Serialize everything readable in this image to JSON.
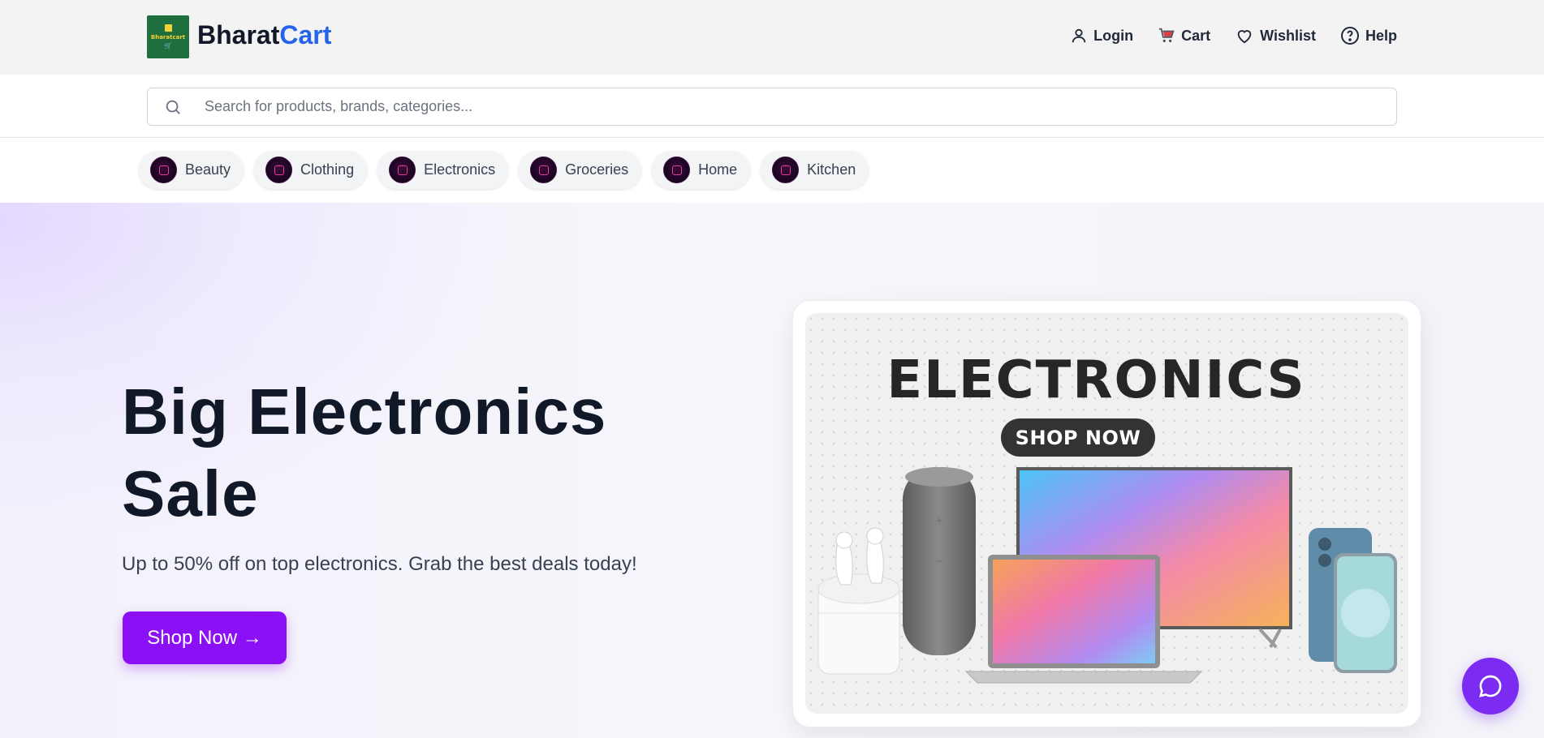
{
  "header": {
    "logo_text": "Bharatcart",
    "brand_part1": "Bharat",
    "brand_part2": "Cart",
    "brand_color": "#2563eb",
    "nav": [
      {
        "label": "Login",
        "icon": "user-icon"
      },
      {
        "label": "Cart",
        "icon": "cart-icon"
      },
      {
        "label": "Wishlist",
        "icon": "heart-icon"
      },
      {
        "label": "Help",
        "icon": "help-circle-icon"
      }
    ]
  },
  "search": {
    "placeholder": "Search for products, brands, categories...",
    "value": "",
    "icon": "search-icon"
  },
  "categories": [
    {
      "label": "Beauty"
    },
    {
      "label": "Clothing"
    },
    {
      "label": "Electronics"
    },
    {
      "label": "Groceries"
    },
    {
      "label": "Home"
    },
    {
      "label": "Kitchen"
    }
  ],
  "hero": {
    "title": "Big Electronics Sale",
    "subtitle": "Up to 50% off on top electronics. Grab the best deals today!",
    "cta_label": "Shop Now →",
    "cta_color": "#8b10f5"
  },
  "promo": {
    "title": "ELECTRONICS",
    "pill_label": "SHOP NOW"
  },
  "chat": {
    "icon": "chat-bubble-icon",
    "color": "#7c2cf2"
  }
}
